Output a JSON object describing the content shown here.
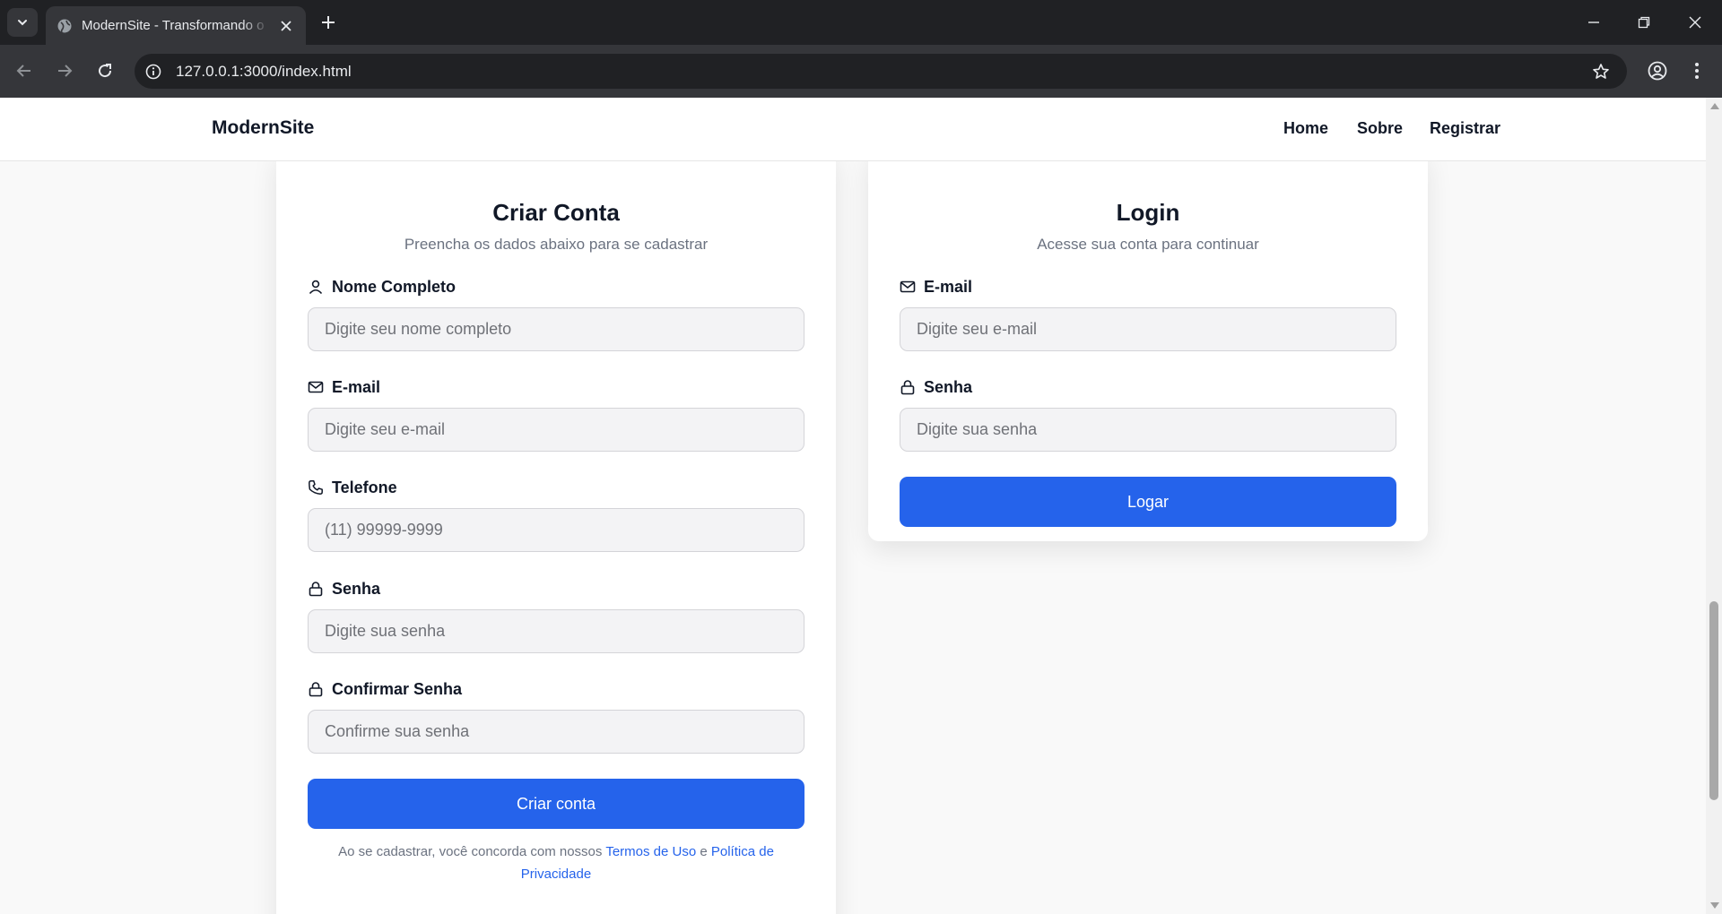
{
  "browser": {
    "tab_title": "ModernSite - Transformando o",
    "url": "127.0.0.1:3000/index.html"
  },
  "site": {
    "brand": "ModernSite",
    "nav": [
      "Home",
      "Sobre",
      "Registrar"
    ]
  },
  "register": {
    "title": "Criar Conta",
    "subtitle": "Preencha os dados abaixo para se cadastrar",
    "fields": [
      {
        "label": "Nome Completo",
        "placeholder": "Digite seu nome completo",
        "icon": "user-icon"
      },
      {
        "label": "E-mail",
        "placeholder": "Digite seu e-mail",
        "icon": "mail-icon"
      },
      {
        "label": "Telefone",
        "placeholder": "(11) 99999-9999",
        "icon": "phone-icon"
      },
      {
        "label": "Senha",
        "placeholder": "Digite sua senha",
        "icon": "lock-icon"
      },
      {
        "label": "Confirmar Senha",
        "placeholder": "Confirme sua senha",
        "icon": "lock-icon"
      }
    ],
    "submit": "Criar conta",
    "terms": {
      "prefix": "Ao se cadastrar, você concorda com nossos",
      "terms_link": "Termos de Uso",
      "and": "e",
      "privacy_link": "Política de Privacidade"
    }
  },
  "login": {
    "title": "Login",
    "subtitle": "Acesse sua conta para continuar",
    "fields": [
      {
        "label": "E-mail",
        "placeholder": "Digite seu e-mail",
        "icon": "mail-icon"
      },
      {
        "label": "Senha",
        "placeholder": "Digite sua senha",
        "icon": "lock-icon"
      }
    ],
    "submit": "Logar"
  },
  "colors": {
    "accent": "#2563eb",
    "tabbar": "#202124",
    "toolbar": "#35363a"
  }
}
